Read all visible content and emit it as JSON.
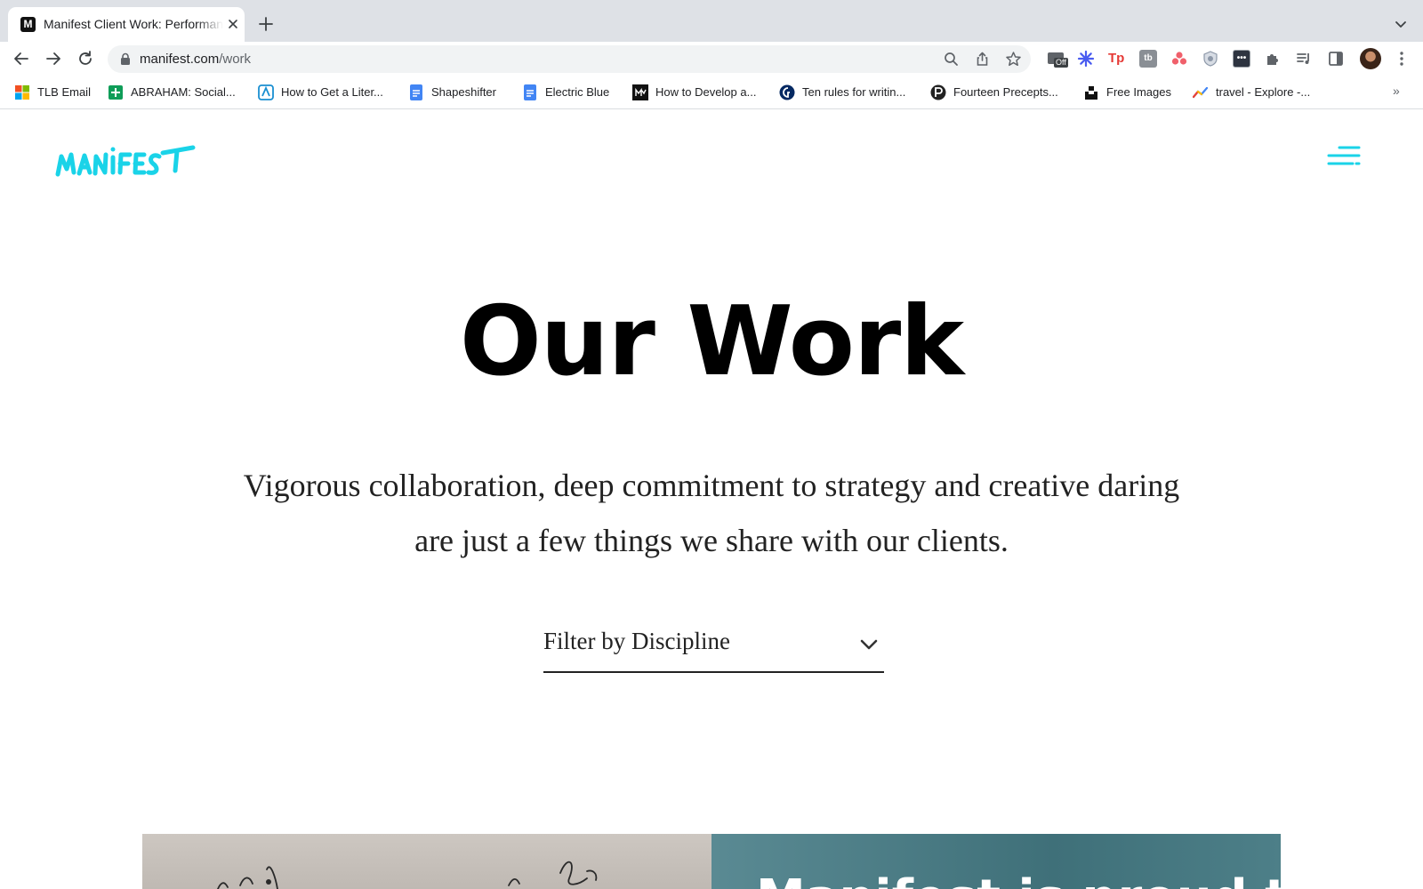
{
  "browser": {
    "tab": {
      "title": "Manifest Client Work: Performance",
      "favicon_letter": "M"
    },
    "url": {
      "domain": "manifest.com",
      "path": "/work"
    },
    "bookmarks": [
      {
        "label": "TLB Email",
        "icon": "microsoft-icon"
      },
      {
        "label": "ABRAHAM: Social...",
        "icon": "sheets-icon"
      },
      {
        "label": "How to Get a Liter...",
        "icon": "bookmark-site-icon"
      },
      {
        "label": "Shapeshifter",
        "icon": "docs-icon"
      },
      {
        "label": "Electric Blue",
        "icon": "docs-icon"
      },
      {
        "label": "How to Develop a...",
        "icon": "masterclass-icon"
      },
      {
        "label": "Ten rules for writin...",
        "icon": "guardian-icon"
      },
      {
        "label": "Fourteen Precepts...",
        "icon": "paris-review-icon"
      },
      {
        "label": "Free Images",
        "icon": "unsplash-icon"
      },
      {
        "label": "travel - Explore -...",
        "icon": "trends-icon"
      }
    ],
    "bookmarks_more": "»",
    "extension_badge": "Off"
  },
  "site": {
    "logo_text": "manifest",
    "accent_color": "#1ad3e8",
    "hero": {
      "title": "Our Work",
      "subtitle_line1": "Vigorous collaboration, deep commitment to strategy and creative daring",
      "subtitle_line2": "are just a few things we share with our clients."
    },
    "filter": {
      "label": "Filter by Discipline"
    },
    "cards": [
      {
        "heading": ""
      },
      {
        "heading": "Manifest is proud to"
      }
    ]
  }
}
